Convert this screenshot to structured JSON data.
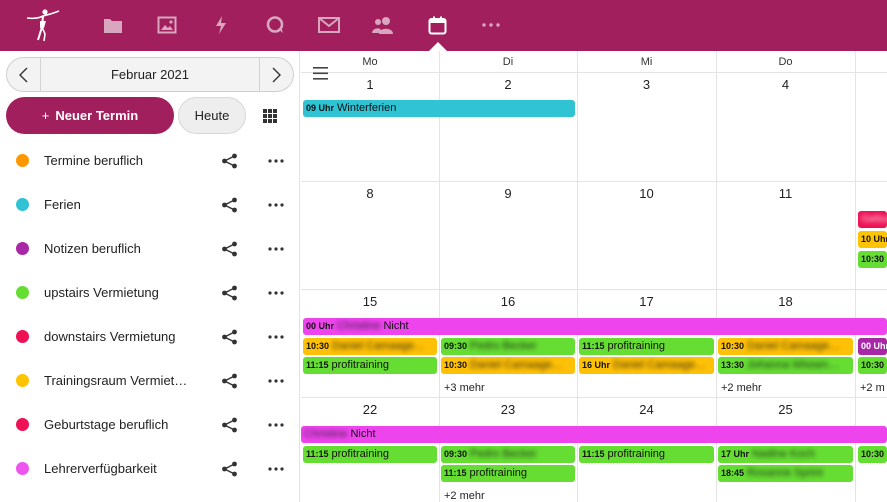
{
  "colors": {
    "brand": "#a01f5c",
    "cal_orange": "#ff9800",
    "cal_teal": "#26c6da",
    "cal_purple": "#9c27b0",
    "cal_green": "#66dd33",
    "cal_red": "#ee1155",
    "cal_yellow": "#ffc107",
    "cal_pink": "#ee44ee"
  },
  "header": {
    "nav_icons": [
      "folder-icon",
      "image-icon",
      "lightning-icon",
      "chat-icon",
      "mail-icon",
      "contacts-icon",
      "calendar-icon",
      "more-apps-icon"
    ],
    "active": "calendar-icon"
  },
  "sidebar": {
    "month_label": "Februar 2021",
    "new_event_plus": "+",
    "new_event_label": "Neuer Termin",
    "today_label": "Heute",
    "calendars": [
      {
        "name": "Termine beruflich",
        "color": "#ff9800"
      },
      {
        "name": "Ferien",
        "color": "#2fc3d4"
      },
      {
        "name": "Notizen beruflich",
        "color": "#a727a7"
      },
      {
        "name": "upstairs Vermietung",
        "color": "#66dd33"
      },
      {
        "name": "downstairs Vermietung",
        "color": "#ee1155"
      },
      {
        "name": "Trainingsraum Vermiet…",
        "color": "#ffc400"
      },
      {
        "name": "Geburtstage beruflich",
        "color": "#ee1155"
      },
      {
        "name": "Lehrerverfügbarkeit",
        "color": "#ee55ee"
      }
    ]
  },
  "calendar": {
    "day_headers": [
      "Mo",
      "Di",
      "Mi",
      "Do"
    ],
    "weeks": [
      [
        "1",
        "2",
        "3",
        "4"
      ],
      [
        "8",
        "9",
        "10",
        "11"
      ],
      [
        "15",
        "16",
        "17",
        "18"
      ],
      [
        "22",
        "23",
        "24",
        "25"
      ]
    ],
    "events": {
      "w1_ferien": {
        "time": "09 Uhr",
        "title": "Winterferien"
      },
      "w2_fri_top": {
        "time": "",
        "title": "Geburtstag"
      },
      "w2_fri_mid": {
        "time": "10 Uhr",
        "title": ""
      },
      "w2_fri_bot": {
        "time": "10:30",
        "title": ""
      },
      "w3_allday": {
        "time": "00 Uhr",
        "title": "Nicht",
        "blur": "Christine"
      },
      "w3_mo_1": {
        "time": "10:30",
        "title": "",
        "blur": "Daniel Camaage…"
      },
      "w3_mo_2": {
        "time": "11:15",
        "title": "profitraining"
      },
      "w3_di_1": {
        "time": "09:30",
        "title": "",
        "blur": "Pedro Becker"
      },
      "w3_di_2": {
        "time": "10:30",
        "title": "",
        "blur": "Daniel Camaage…"
      },
      "w3_mi_1": {
        "time": "11:15",
        "title": "profitraining"
      },
      "w3_mi_2": {
        "time": "16 Uhr",
        "title": "",
        "blur": "Daniel Camaage…"
      },
      "w3_do_1": {
        "time": "10:30",
        "title": "",
        "blur": "Daniel Camaage…"
      },
      "w3_do_2": {
        "time": "13:30",
        "title": "",
        "blur": "Johanna Wissen…"
      },
      "w3_fr_1": {
        "time": "00 Uhr",
        "title": ""
      },
      "w3_fr_2": {
        "time": "10:30",
        "title": ""
      },
      "w4_allday": {
        "time": "",
        "title": "Nicht",
        "blur": "Christine"
      },
      "w4_mo_1": {
        "time": "11:15",
        "title": "profitraining"
      },
      "w4_di_1": {
        "time": "09:30",
        "title": "",
        "blur": "Pedro Becker"
      },
      "w4_di_2": {
        "time": "11:15",
        "title": "profitraining"
      },
      "w4_mi_1": {
        "time": "11:15",
        "title": "profitraining"
      },
      "w4_do_1": {
        "time": "17 Uhr",
        "title": "",
        "blur": "Nadine Koch"
      },
      "w4_do_2": {
        "time": "18:45",
        "title": "",
        "blur": "Roxanne Sprint"
      },
      "w4_fr_1": {
        "time": "10:30",
        "title": ""
      }
    },
    "more": {
      "w3_di": "+3 mehr",
      "w3_do": "+2 mehr",
      "w3_fr": "+2 m",
      "w4_di": "+2 mehr"
    }
  }
}
